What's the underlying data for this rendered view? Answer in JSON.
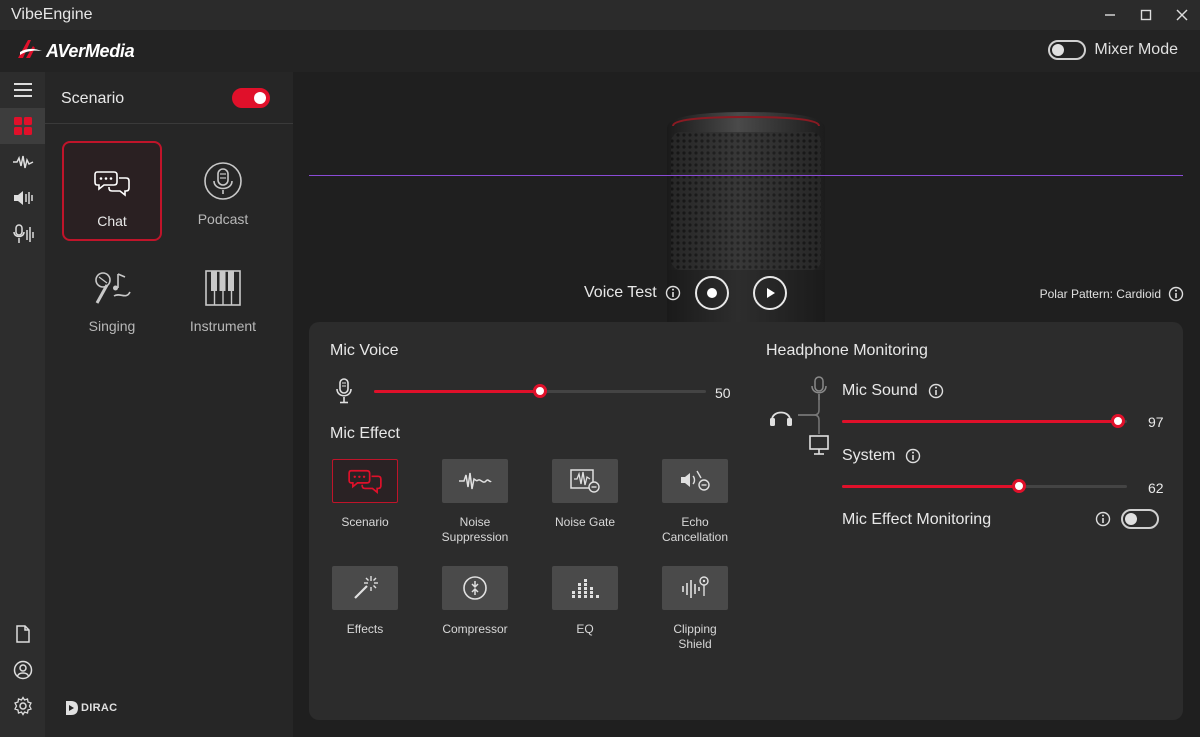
{
  "window": {
    "title": "VibeEngine"
  },
  "brand": {
    "logo_text": "AVerMedia",
    "mixer_mode_label": "Mixer Mode",
    "mixer_mode_on": false
  },
  "rail": {
    "items": [
      {
        "icon": "menu-icon"
      },
      {
        "icon": "grid-icon",
        "active": true
      },
      {
        "icon": "waveform-icon"
      },
      {
        "icon": "speaker-icon"
      },
      {
        "icon": "mic-wave-icon"
      },
      {
        "icon": "document-icon"
      },
      {
        "icon": "user-icon"
      },
      {
        "icon": "gear-icon"
      }
    ]
  },
  "scenario": {
    "title": "Scenario",
    "enabled": true,
    "items": [
      {
        "label": "Chat",
        "icon": "chat-icon",
        "selected": true
      },
      {
        "label": "Podcast",
        "icon": "podcast-icon",
        "selected": false
      },
      {
        "label": "Singing",
        "icon": "singing-icon",
        "selected": false
      },
      {
        "label": "Instrument",
        "icon": "piano-icon",
        "selected": false
      }
    ],
    "footer_logo": "DIRAC"
  },
  "preview": {
    "voice_test_label": "Voice Test",
    "polar_pattern_label": "Polar Pattern: Cardioid"
  },
  "mic_voice": {
    "title": "Mic Voice",
    "value": 50,
    "max": 100
  },
  "mic_effect": {
    "title": "Mic Effect",
    "items": [
      {
        "label": "Scenario",
        "icon": "chat-icon",
        "selected": true
      },
      {
        "label": "Noise\nSuppression",
        "icon": "noise-suppression-icon",
        "selected": false
      },
      {
        "label": "Noise Gate",
        "icon": "noise-gate-icon",
        "selected": false
      },
      {
        "label": "Echo\nCancellation",
        "icon": "echo-cancellation-icon",
        "selected": false
      },
      {
        "label": "Effects",
        "icon": "magic-wand-icon",
        "selected": false
      },
      {
        "label": "Compressor",
        "icon": "compressor-icon",
        "selected": false
      },
      {
        "label": "EQ",
        "icon": "eq-icon",
        "selected": false
      },
      {
        "label": "Clipping\nShield",
        "icon": "clipping-shield-icon",
        "selected": false
      }
    ]
  },
  "headphone": {
    "title": "Headphone Monitoring",
    "mic_sound": {
      "label": "Mic Sound",
      "value": 97,
      "max": 100
    },
    "system": {
      "label": "System",
      "value": 62,
      "max": 100
    },
    "effect_monitoring": {
      "label": "Mic Effect Monitoring",
      "on": false
    }
  },
  "colors": {
    "accent": "#e0102a",
    "background": "#1f1f1f",
    "card": "#2c2c2c"
  }
}
